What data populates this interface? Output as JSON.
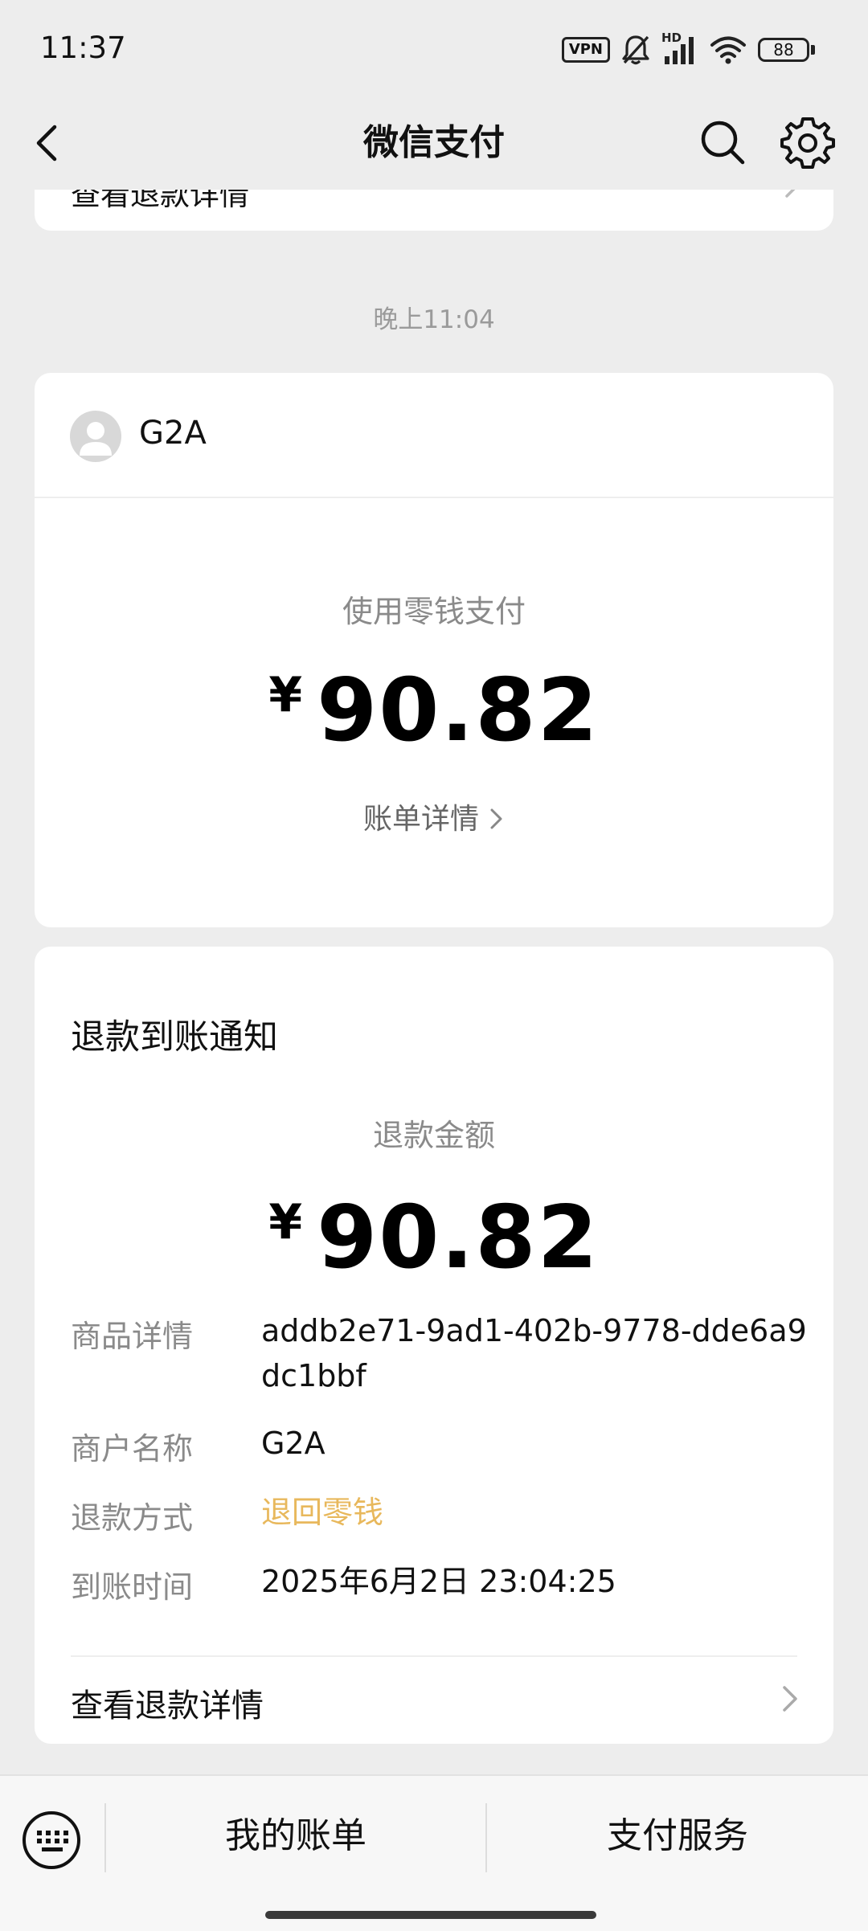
{
  "status_bar": {
    "time": "11:37",
    "vpn": "VPN",
    "hd": "HD",
    "battery": "88",
    "icons": [
      "vpn-icon",
      "bell-muted-icon",
      "signal-icon",
      "wifi-icon",
      "battery-icon"
    ]
  },
  "nav": {
    "title": "微信支付",
    "icons": [
      "back-arrow-icon",
      "search-icon",
      "gear-icon"
    ]
  },
  "partial_card": {
    "link": "查看退款详情"
  },
  "timestamp": "晚上11:04",
  "payment_card": {
    "merchant": "G2A",
    "method": "使用零钱支付",
    "currency": "¥",
    "amount": "90.82",
    "bill_detail": "账单详情"
  },
  "refund_card": {
    "title": "退款到账通知",
    "amount_label": "退款金额",
    "currency": "¥",
    "amount": "90.82",
    "rows": [
      {
        "label": "商品详情",
        "value": "addb2e71-9ad1-402b-9778-dde6a9dc1bbf"
      },
      {
        "label": "商户名称",
        "value": "G2A"
      },
      {
        "label": "退款方式",
        "value": "退回零钱"
      },
      {
        "label": "到账时间",
        "value": "2025年6月2日 23:04:25"
      }
    ],
    "link": "查看退款详情"
  },
  "bottom_bar": {
    "bills": "我的账单",
    "services": "支付服务"
  },
  "colors": {
    "background": "#ededed",
    "card": "#ffffff",
    "accent": "#e8b85c",
    "secondary_text": "#8a8a8a"
  }
}
